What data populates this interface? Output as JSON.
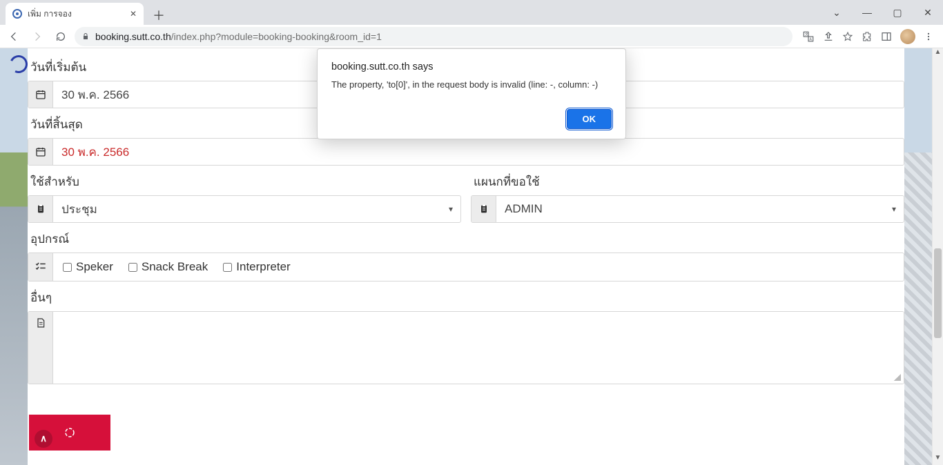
{
  "tab": {
    "title": "เพิ่ม การจอง"
  },
  "url": {
    "host": "booking.sutt.co.th",
    "path": "/index.php?module=booking-booking&room_id=1"
  },
  "dialog": {
    "title": "booking.sutt.co.th says",
    "message": "The property, 'to[0]', in the request body is invalid (line: -, column: -)",
    "ok": "OK"
  },
  "form": {
    "start_date": {
      "label": "วันที่เริ่มต้น",
      "value": "30 พ.ค. 2566"
    },
    "end_date": {
      "label": "วันที่สิ้นสุด",
      "value": "30 พ.ค. 2566"
    },
    "use_for": {
      "label": "ใช้สำหรับ",
      "value": "ประชุม"
    },
    "department": {
      "label": "แผนกที่ขอใช้",
      "value": "ADMIN"
    },
    "equipment": {
      "label": "อุปกรณ์",
      "opt1": "Speker",
      "opt2": "Snack Break",
      "opt3": "Interpreter"
    },
    "other": {
      "label": "อื่นๆ",
      "value": ""
    }
  }
}
